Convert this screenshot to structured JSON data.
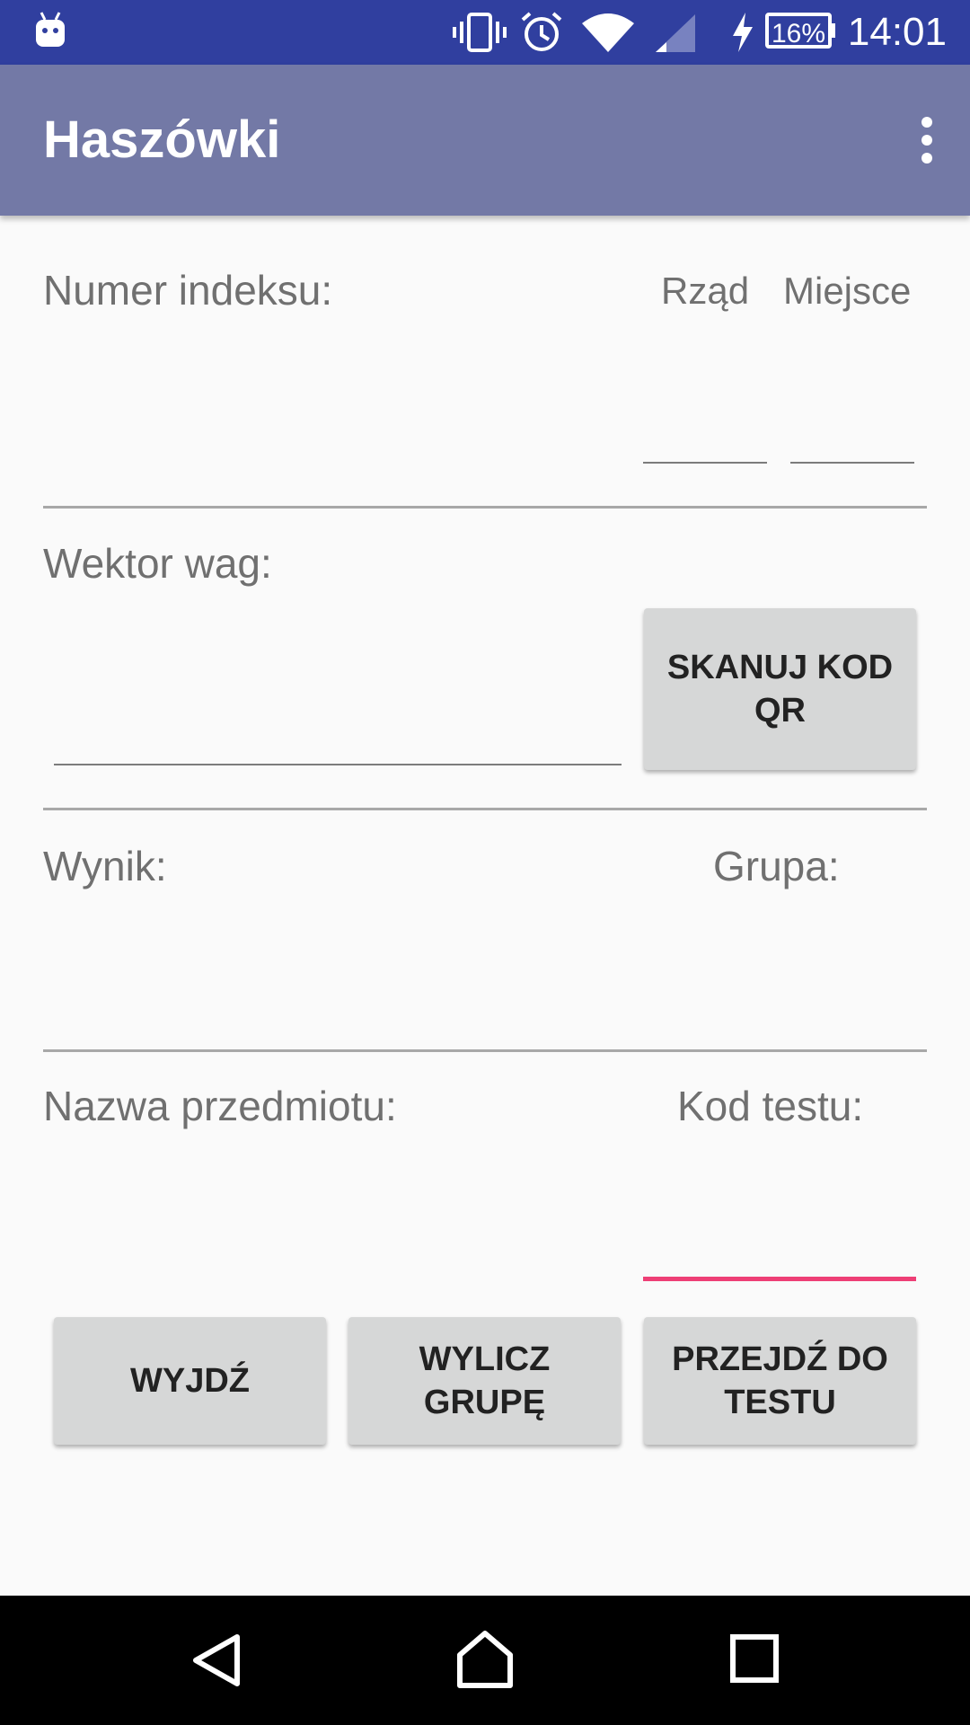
{
  "status_bar": {
    "time": "14:01",
    "battery_percent": "16%",
    "icons": [
      "android-notification-icon",
      "vibrate-icon",
      "alarm-icon",
      "wifi-icon",
      "cell-signal-icon",
      "charging-icon",
      "battery-icon"
    ]
  },
  "app_bar": {
    "title": "Haszówki",
    "menu_icon": "more-vert-icon"
  },
  "form": {
    "index_label": "Numer indeksu:",
    "row_label": "Rząd",
    "seat_label": "Miejsce",
    "weights_label": "Wektor wag:",
    "scan_button": "SKANUJ KOD\nQR",
    "result_label": "Wynik:",
    "group_label": "Grupa:",
    "subject_label": "Nazwa przedmiotu:",
    "test_code_label": "Kod testu:"
  },
  "buttons": {
    "exit": "WYJDŹ",
    "compute_group": "WYLICZ\nGRUPĘ",
    "go_to_test": "PRZEJDŹ DO\nTESTU"
  },
  "nav_bar": {
    "icons": [
      "back-icon",
      "home-icon",
      "recents-icon"
    ]
  },
  "colors": {
    "status_bar": "#303f9f",
    "app_bar": "#7379a6",
    "accent": "#ee3f76",
    "button": "#d6d7d7"
  }
}
